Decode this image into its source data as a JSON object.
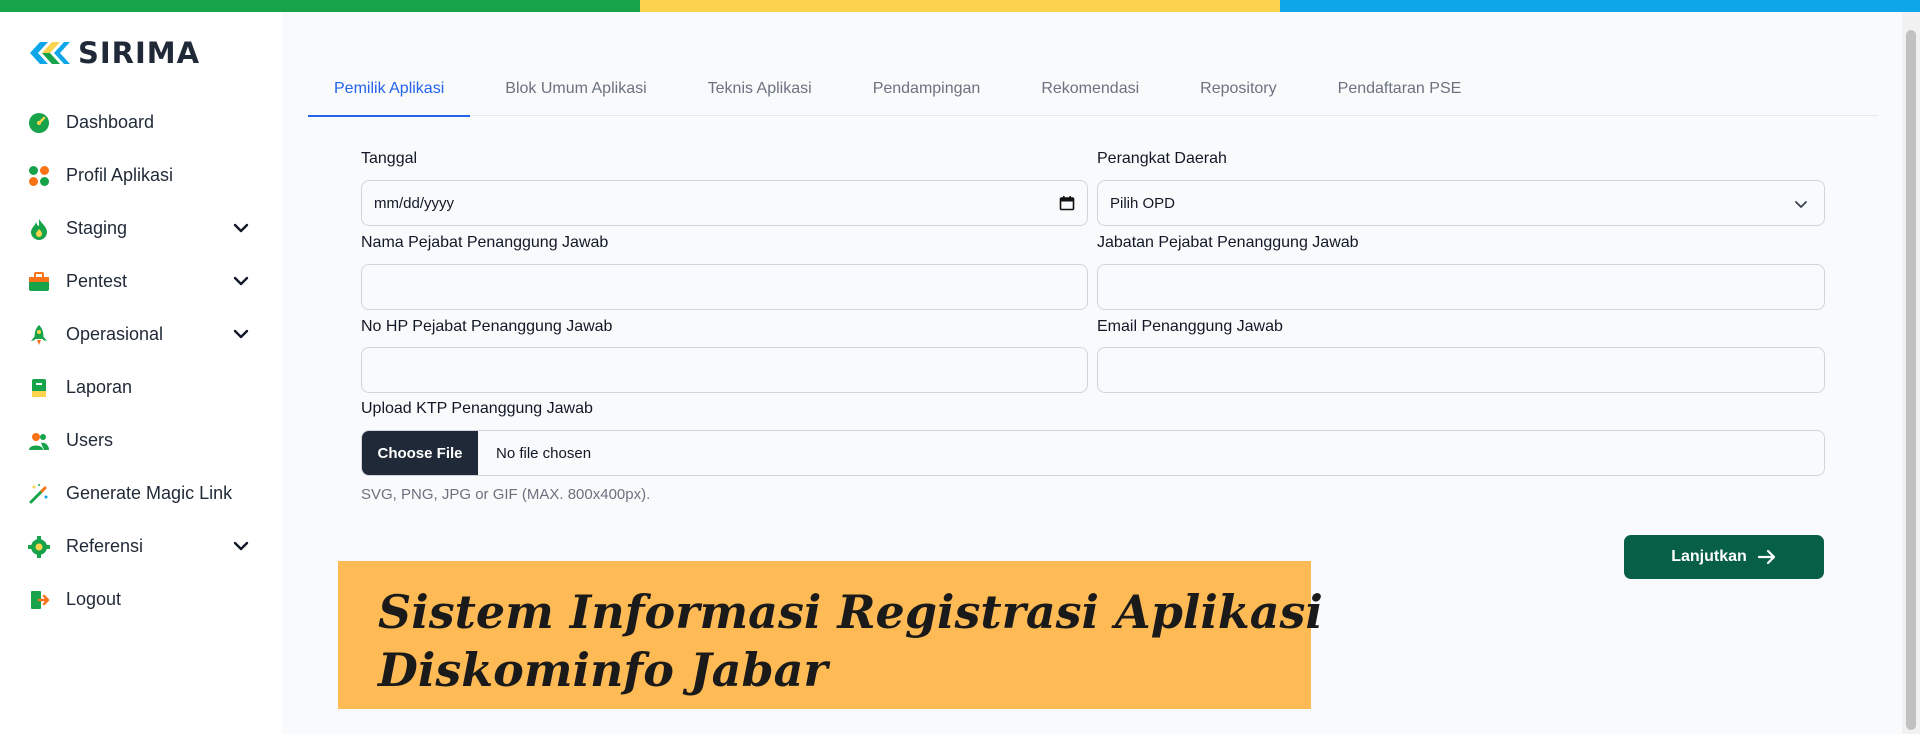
{
  "colors": {
    "green": "#16a34a",
    "yellow": "#fcd34d",
    "blue": "#0ea5e9",
    "accent": "#2563eb",
    "primary_button": "#065f46",
    "banner": "#fdba55"
  },
  "brand": {
    "name": "SIRIMA"
  },
  "sidebar": {
    "items": [
      {
        "label": "Dashboard",
        "icon": "gauge-icon"
      },
      {
        "label": "Profil Aplikasi",
        "icon": "grid-icon"
      },
      {
        "label": "Staging",
        "icon": "flame-icon",
        "has_submenu": true
      },
      {
        "label": "Pentest",
        "icon": "briefcase-icon",
        "has_submenu": true
      },
      {
        "label": "Operasional",
        "icon": "rocket-icon",
        "has_submenu": true
      },
      {
        "label": "Laporan",
        "icon": "book-icon"
      },
      {
        "label": "Users",
        "icon": "users-icon"
      },
      {
        "label": "Generate Magic Link",
        "icon": "magic-wand-icon"
      },
      {
        "label": "Referensi",
        "icon": "gear-icon",
        "has_submenu": true
      },
      {
        "label": "Logout",
        "icon": "logout-icon"
      }
    ]
  },
  "tabs": [
    {
      "label": "Pemilik Aplikasi",
      "active": true
    },
    {
      "label": "Blok Umum Aplikasi"
    },
    {
      "label": "Teknis Aplikasi"
    },
    {
      "label": "Pendampingan"
    },
    {
      "label": "Rekomendasi"
    },
    {
      "label": "Repository"
    },
    {
      "label": "Pendaftaran PSE"
    }
  ],
  "form": {
    "tanggal": {
      "label": "Tanggal",
      "placeholder": "mm/dd/yyyy"
    },
    "perangkat_daerah": {
      "label": "Perangkat Daerah",
      "selected": "Pilih OPD"
    },
    "nama_pejabat": {
      "label": "Nama Pejabat Penanggung Jawab",
      "value": ""
    },
    "jabatan_pejabat": {
      "label": "Jabatan Pejabat Penanggung Jawab",
      "value": ""
    },
    "no_hp": {
      "label": "No HP Pejabat Penanggung Jawab",
      "value": ""
    },
    "email": {
      "label": "Email Penanggung Jawab",
      "value": ""
    },
    "upload_ktp": {
      "label": "Upload KTP Penanggung Jawab",
      "button": "Choose File",
      "status": "No file chosen",
      "hint": "SVG, PNG, JPG or GIF (MAX. 800x400px)."
    },
    "submit_label": "Lanjutkan"
  },
  "banner": {
    "line1": "Sistem Informasi Registrasi Aplikasi",
    "line2": "Diskominfo Jabar"
  }
}
